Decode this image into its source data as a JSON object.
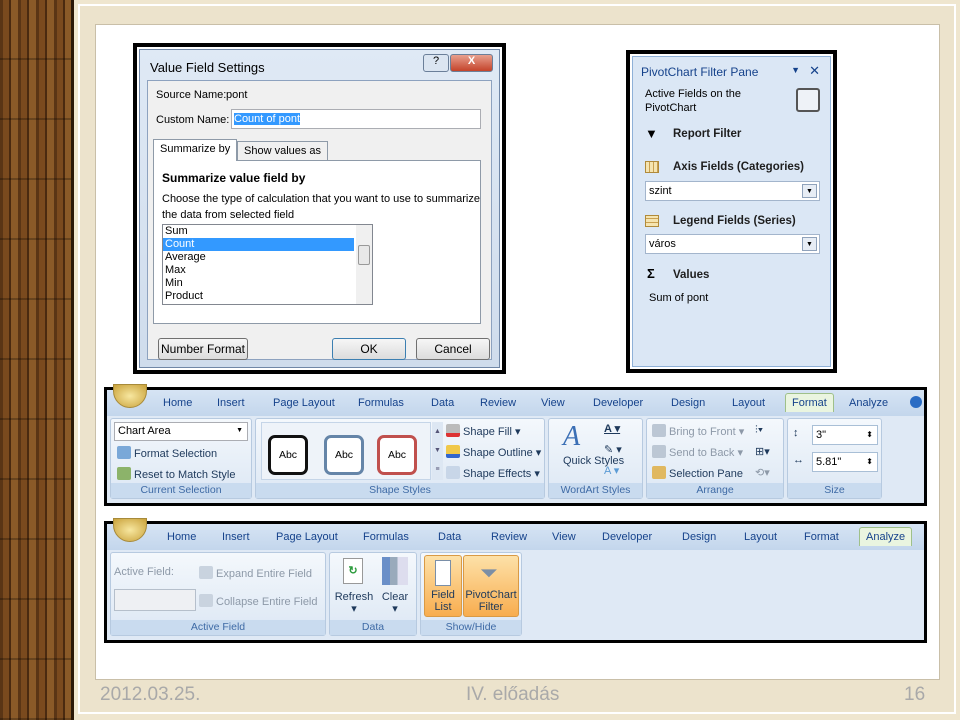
{
  "slide": {
    "date": "2012.03.25.",
    "title": "IV. előadás",
    "page": "16"
  },
  "dialog": {
    "title": "Value Field Settings",
    "help": "?",
    "close": "X",
    "source_label": "Source Name:",
    "source_value": "pont",
    "custom_label": "Custom Name:",
    "custom_value": "Count of pont",
    "tabs": [
      "Summarize by",
      "Show values as"
    ],
    "section": "Summarize value field by",
    "description": "Choose the type of calculation that you want to use to summarize the data from selected field",
    "functions": [
      "Sum",
      "Count",
      "Average",
      "Max",
      "Min",
      "Product"
    ],
    "selected": "Count",
    "number_format": "Number Format",
    "ok": "OK",
    "cancel": "Cancel"
  },
  "pane": {
    "title": "PivotChart Filter Pane",
    "active_fields": "Active Fields on the PivotChart",
    "report_filter": "Report Filter",
    "axis_fields": "Axis Fields (Categories)",
    "axis_value": "szint",
    "legend_fields": "Legend Fields (Series)",
    "legend_value": "város",
    "values": "Values",
    "values_item": "Sum of pont"
  },
  "ribbon1": {
    "tabs": [
      "Home",
      "Insert",
      "Page Layout",
      "Formulas",
      "Data",
      "Review",
      "View",
      "Developer",
      "Design",
      "Layout",
      "Format",
      "Analyze"
    ],
    "active_tab": "Format",
    "chart_element": "Chart Area",
    "format_selection": "Format Selection",
    "reset_style": "Reset to Match Style",
    "group_current": "Current Selection",
    "abc": [
      "Abc",
      "Abc",
      "Abc"
    ],
    "shape_fill": "Shape Fill",
    "shape_outline": "Shape Outline",
    "shape_effects": "Shape Effects",
    "group_shape": "Shape Styles",
    "quick_styles": "Quick Styles",
    "group_wordart": "WordArt Styles",
    "bring_front": "Bring to Front",
    "send_back": "Send to Back",
    "selection_pane": "Selection Pane",
    "group_arrange": "Arrange",
    "height": "3\"",
    "width": "5.81\"",
    "group_size": "Size"
  },
  "ribbon2": {
    "tabs": [
      "Home",
      "Insert",
      "Page Layout",
      "Formulas",
      "Data",
      "Review",
      "View",
      "Developer",
      "Design",
      "Layout",
      "Format",
      "Analyze"
    ],
    "active_tab": "Analyze",
    "active_field": "Active Field:",
    "expand": "Expand Entire Field",
    "collapse": "Collapse Entire Field",
    "group_active": "Active Field",
    "refresh": "Refresh",
    "clear": "Clear",
    "group_data": "Data",
    "field_list": "Field List",
    "pivot_filter": "PivotChart Filter",
    "group_show": "Show/Hide"
  }
}
